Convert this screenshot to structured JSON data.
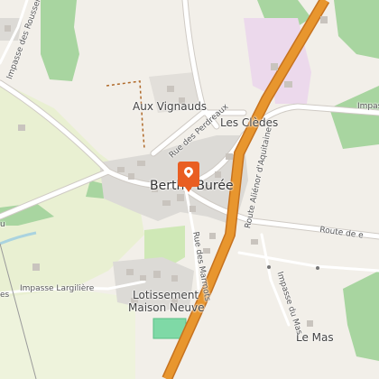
{
  "map": {
    "colors": {
      "background": "#f2efe9",
      "forest": "#a8d5a0",
      "meadow": "#e9f0d2",
      "residential": "#dcdad6",
      "building": "#c9c4be",
      "highway": "#e8962e",
      "highway_casing": "#c6721f",
      "road": "#ffffff",
      "road_casing": "#cfcac4",
      "industrial": "#ecd9ec",
      "sports": "#7fd9a6",
      "water": "#aad3df",
      "marker": "#e95e22"
    },
    "labels": {
      "town": "Berthe Burée",
      "aux_vignauds": "Aux Vignauds",
      "les_cledes": "Les Clèdes",
      "lotissement_line1": "Lotissement",
      "lotissement_line2": "Maison Neuve",
      "le_mas": "Le Mas",
      "route_aquitaine": "Route Aliénor d'Aquitaine",
      "rue_perdreaux": "Rue des Perdreaux",
      "rue_marmots": "Rue des Marmots",
      "impasse_largiliere": "Impasse Largilière",
      "impasse_roussero": "Impasse des Roussero",
      "impasse_mas": "Impasse du Mas",
      "route_de_e": "Route de e",
      "impasse_right": "Impasse",
      "edge_u": "u",
      "edge_es": "es"
    },
    "marker_icon": "map-pin-icon"
  }
}
